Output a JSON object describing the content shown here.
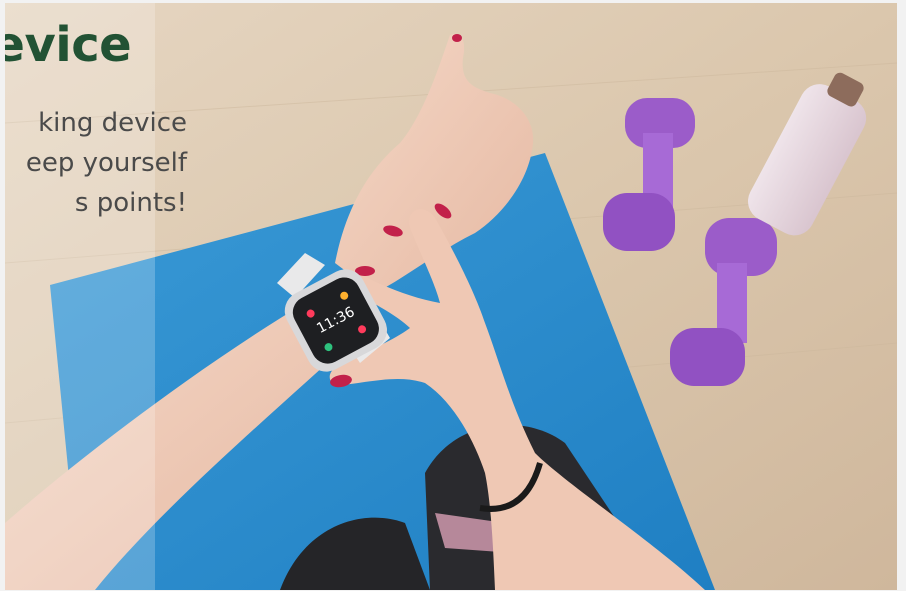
{
  "hero": {
    "title": "ness Device",
    "description_lines": [
      "king  device",
      "eep yourself",
      "s points!"
    ]
  },
  "image": {
    "subject": "smartwatch on wrist",
    "watch_time": "11:36"
  },
  "colors": {
    "title": "#225234",
    "text": "#4a4a4a",
    "mat": "#2f8fcf",
    "floor": "#d9c7ae",
    "dumbbell": "#9b5cc9"
  }
}
